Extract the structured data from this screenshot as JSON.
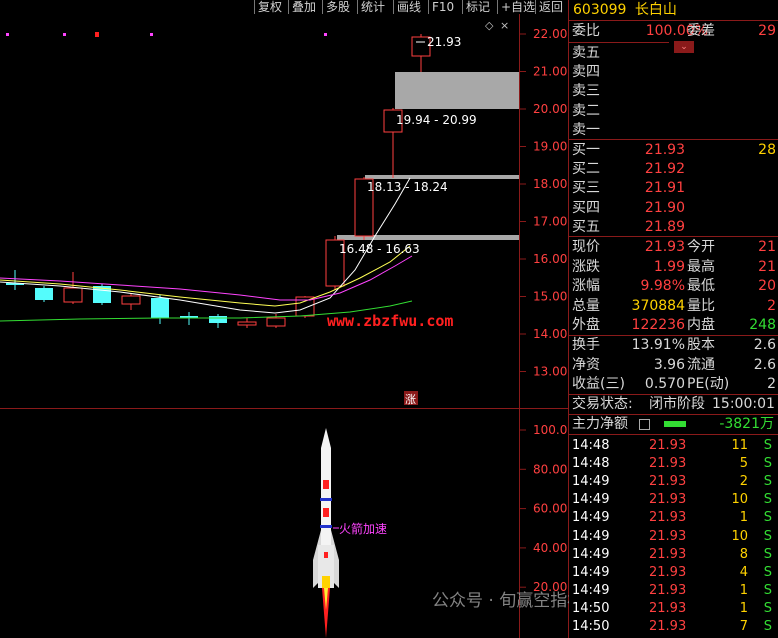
{
  "toolbar": [
    "复权",
    "叠加",
    "多股",
    "统计",
    "画线",
    "F10",
    "标记",
    "+自选",
    "返回"
  ],
  "stock": {
    "code": "603099",
    "name": "长白山"
  },
  "weibi": {
    "label": "委比",
    "value": "100.00%",
    "label2": "委差",
    "value2": "29"
  },
  "sell_levels": [
    "卖五",
    "卖四",
    "卖三",
    "卖二",
    "卖一"
  ],
  "buy_levels": [
    {
      "label": "买一",
      "price": "21.93",
      "vol": "28"
    },
    {
      "label": "买二",
      "price": "21.92",
      "vol": ""
    },
    {
      "label": "买三",
      "price": "21.91",
      "vol": ""
    },
    {
      "label": "买四",
      "price": "21.90",
      "vol": ""
    },
    {
      "label": "买五",
      "price": "21.89",
      "vol": ""
    }
  ],
  "quote": [
    {
      "l1": "现价",
      "v1": "21.93",
      "c1": "#ff4040",
      "l2": "今开",
      "v2": "21",
      "c2": "#ff4040"
    },
    {
      "l1": "涨跌",
      "v1": "1.99",
      "c1": "#ff4040",
      "l2": "最高",
      "v2": "21",
      "c2": "#ff4040"
    },
    {
      "l1": "涨幅",
      "v1": "9.98%",
      "c1": "#ff4040",
      "l2": "最低",
      "v2": "20",
      "c2": "#ff4040"
    },
    {
      "l1": "总量",
      "v1": "370884",
      "c1": "#ffd200",
      "l2": "量比",
      "v2": "2",
      "c2": "#ff4040"
    },
    {
      "l1": "外盘",
      "v1": "122236",
      "c1": "#ff4040",
      "l2": "内盘",
      "v2": "248",
      "c2": "#33dd33"
    }
  ],
  "fundamentals": [
    {
      "l1": "换手",
      "v1": "13.91%",
      "l2": "股本",
      "v2": "2.6"
    },
    {
      "l1": "净资",
      "v1": "3.96",
      "l2": "流通",
      "v2": "2.6"
    },
    {
      "l1": "收益(三)",
      "v1": "0.570",
      "l2": "PE(动)",
      "v2": "2"
    }
  ],
  "trade_status": {
    "label": "交易状态:",
    "value": "闭市阶段",
    "time": "15:00:01"
  },
  "main_net": {
    "label": "主力净额",
    "value": "-3821万"
  },
  "ticks": [
    {
      "t": "14:48",
      "p": "21.93",
      "v": "11",
      "s": "S"
    },
    {
      "t": "14:48",
      "p": "21.93",
      "v": "5",
      "s": "S"
    },
    {
      "t": "14:49",
      "p": "21.93",
      "v": "2",
      "s": "S"
    },
    {
      "t": "14:49",
      "p": "21.93",
      "v": "10",
      "s": "S"
    },
    {
      "t": "14:49",
      "p": "21.93",
      "v": "1",
      "s": "S"
    },
    {
      "t": "14:49",
      "p": "21.93",
      "v": "10",
      "s": "S"
    },
    {
      "t": "14:49",
      "p": "21.93",
      "v": "8",
      "s": "S"
    },
    {
      "t": "14:49",
      "p": "21.93",
      "v": "4",
      "s": "S"
    },
    {
      "t": "14:49",
      "p": "21.93",
      "v": "1",
      "s": "S"
    },
    {
      "t": "14:50",
      "p": "21.93",
      "v": "1",
      "s": "S"
    },
    {
      "t": "14:50",
      "p": "21.93",
      "v": "7",
      "s": "S"
    }
  ],
  "chart": {
    "price_axis": [
      "22.00",
      "21.00",
      "20.00",
      "19.00",
      "18.00",
      "17.00",
      "16.00",
      "15.00",
      "14.00",
      "13.00"
    ],
    "ind_axis": [
      "100.0",
      "80.00",
      "60.00",
      "40.00",
      "20.00"
    ],
    "labels": {
      "high": "21.93",
      "gap1": "19.94 - 20.99",
      "gap2": "18.13 - 18.24",
      "gap3": "16.48 - 16.63"
    },
    "watermark_url": "www.zbzfwu.com",
    "zhang": "涨",
    "rocket_label": "火箭加速",
    "footer_wm": "公众号 · 旬赢空指标所"
  },
  "colors": {
    "up": "#ff4040",
    "down": "#54fcfc",
    "ma5": "#ffffff",
    "ma10": "#ffff55",
    "ma20": "#ff44ff",
    "ma60": "#33dd33"
  }
}
